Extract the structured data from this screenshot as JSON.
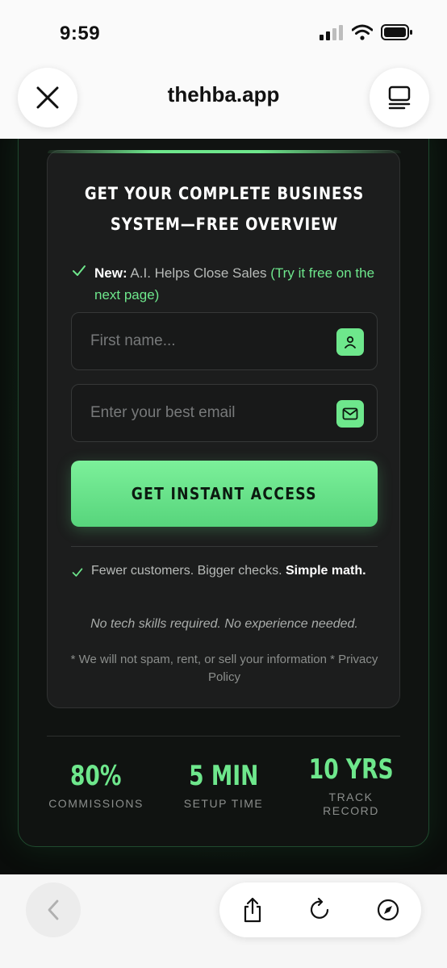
{
  "status_bar": {
    "time": "9:59"
  },
  "browser": {
    "url": "thehba.app"
  },
  "form": {
    "title_line1": "GET YOUR COMPLETE BUSINESS",
    "title_line2": "SYSTEM—FREE OVERVIEW",
    "new_label": "New:",
    "new_text": " A.I. Helps Close Sales ",
    "new_highlight": "(Try it free on the next page)",
    "first_name_placeholder": "First name...",
    "email_placeholder": "Enter your best email",
    "cta_label": "GET INSTANT ACCESS",
    "fewer_text": "Fewer customers. Bigger checks. ",
    "fewer_strong": "Simple math.",
    "no_tech": "No tech skills required. No experience needed.",
    "no_spam": "* We will not spam, rent, or sell your information * Privacy Policy"
  },
  "stats": [
    {
      "value": "80%",
      "label": "COMMISSIONS"
    },
    {
      "value": "5 MIN",
      "label": "SETUP TIME"
    },
    {
      "value": "10 YRS",
      "label": "TRACK RECORD"
    }
  ],
  "icons": {
    "close": "close-icon",
    "tabs": "tabs-icon",
    "user": "user-icon",
    "mail": "mail-icon",
    "check": "check-icon",
    "back": "chevron-left-icon",
    "share": "share-icon",
    "reload": "reload-icon",
    "compass": "compass-icon"
  },
  "colors": {
    "accent": "#6ee78c",
    "card": "#1c1d1d",
    "background": "#0c0f0d"
  }
}
